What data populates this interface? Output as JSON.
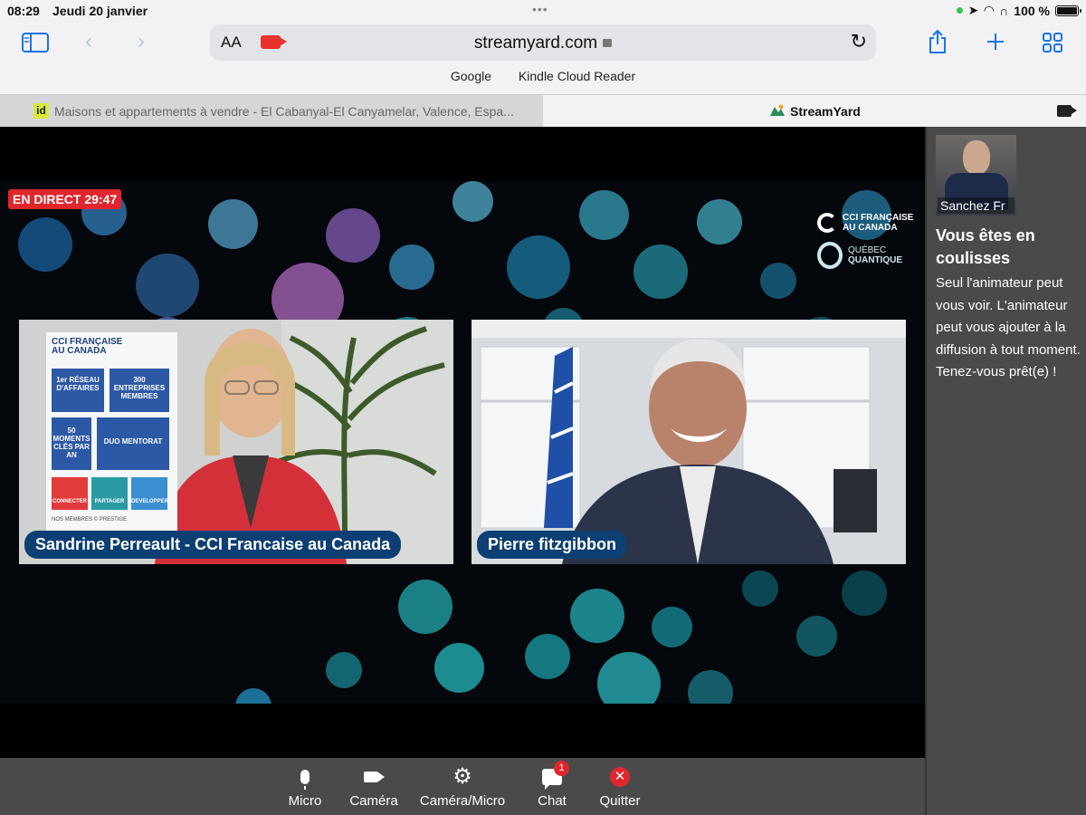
{
  "status": {
    "time": "08:29",
    "date": "Jeudi 20 janvier",
    "battery": "100 %"
  },
  "toolbar": {
    "aa_label": "AA",
    "url": "streamyard.com"
  },
  "bookmarks": [
    "Google",
    "Kindle Cloud Reader"
  ],
  "tabs": [
    {
      "favicon": "id",
      "title": "Maisons et appartements à vendre - El Cabanyal-El Canyamelar, Valence, Espa..."
    },
    {
      "title": "StreamYard"
    }
  ],
  "stage": {
    "live_label": "EN DIRECT 29:47",
    "brand_1": [
      "CCI FRANÇAISE",
      "AU CANADA"
    ],
    "brand_2": [
      "QUÉBEC",
      "QUANTIQUE"
    ],
    "banner": {
      "head": [
        "CCI FRANÇAISE",
        "AU CANADA"
      ],
      "b1": "1er RÉSEAU D'AFFAIRES",
      "b2": "300 ENTREPRISES MEMBRES",
      "b3": "50 MOMENTS CLÉS PAR AN",
      "b4": "DUO MENTORAT",
      "c1": "CONNECTER",
      "c2": "PARTAGER",
      "c3": "DEVELOPPER",
      "foot": "NOS MEMBRES © PRESTIGE"
    },
    "participants": [
      {
        "name": "Sandrine Perreault - CCI Francaise au Canada"
      },
      {
        "name": "Pierre fitzgibbon"
      }
    ]
  },
  "controls": {
    "micro": "Micro",
    "camera": "Caméra",
    "camera_micro": "Caméra/Micro",
    "chat": "Chat",
    "chat_badge": "1",
    "quit": "Quitter"
  },
  "side": {
    "participant_name": "Sanchez Fr",
    "title": "Vous êtes en coulisses",
    "body": "Seul l'animateur peut vous voir. L'animateur peut vous ajouter à la diffusion à tout moment. Tenez-vous prêt(e) !"
  },
  "colors": {
    "accent": "#1a73e8",
    "live": "#e0262c",
    "nameplate": "#0c3f73",
    "panel": "#4a4a4a"
  }
}
